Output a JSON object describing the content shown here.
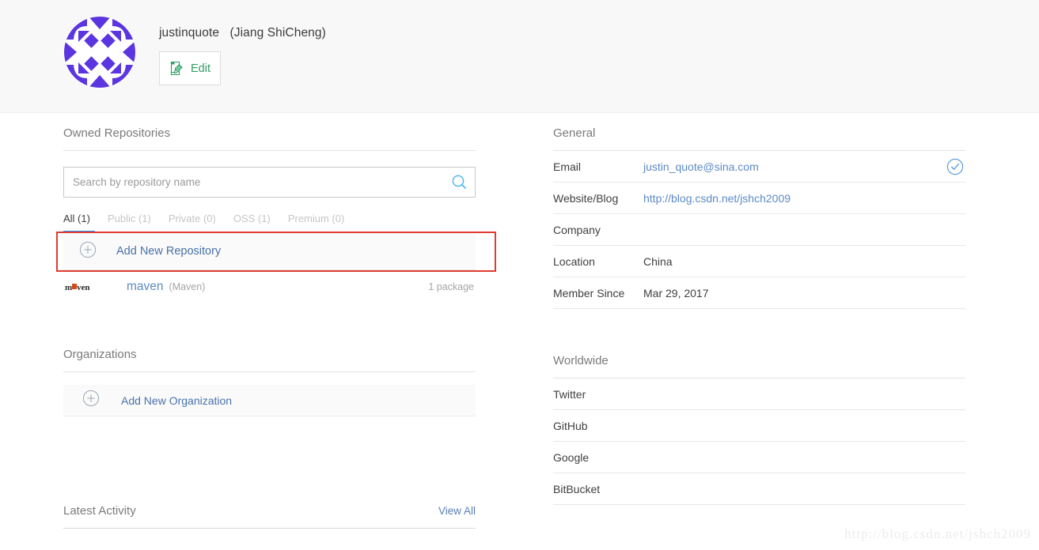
{
  "profile": {
    "username": "justinquote",
    "realname": "(Jiang ShiCheng)",
    "edit_label": "Edit",
    "avatar_alt": "identicon-avatar",
    "avatar_color": "#5b35e0"
  },
  "repositories": {
    "section_title": "Owned Repositories",
    "search": {
      "placeholder": "Search by repository name",
      "value": ""
    },
    "tabs": [
      {
        "label": "All (1)",
        "active": true
      },
      {
        "label": "Public (1)",
        "active": false
      },
      {
        "label": "Private (0)",
        "active": false
      },
      {
        "label": "OSS (1)",
        "active": false
      },
      {
        "label": "Premium (0)",
        "active": false
      }
    ],
    "add_label": "Add New Repository",
    "items": [
      {
        "name": "maven",
        "type": "(Maven)",
        "count": "1 package",
        "logo": "maven-logo"
      }
    ]
  },
  "organizations": {
    "section_title": "Organizations",
    "add_label": "Add New Organization"
  },
  "latest_activity": {
    "section_title": "Latest Activity",
    "view_all_label": "View All"
  },
  "general": {
    "section_title": "General",
    "rows": [
      {
        "label": "Email",
        "value": "justin_quote@sina.com",
        "link": true,
        "verified": true
      },
      {
        "label": "Website/Blog",
        "value": "http://blog.csdn.net/jshch2009",
        "link": true,
        "verified": false
      },
      {
        "label": "Company",
        "value": "",
        "link": false,
        "verified": false
      },
      {
        "label": "Location",
        "value": "China",
        "link": false,
        "verified": false
      },
      {
        "label": "Member Since",
        "value": "Mar 29, 2017",
        "link": false,
        "verified": false
      }
    ]
  },
  "worldwide": {
    "section_title": "Worldwide",
    "rows": [
      {
        "label": "Twitter"
      },
      {
        "label": "GitHub"
      },
      {
        "label": "Google"
      },
      {
        "label": "BitBucket"
      }
    ]
  },
  "watermark": "http://blog.csdn.net/jshch2009",
  "colors": {
    "accent_blue": "#2196f3",
    "link_blue": "#5c8ac4",
    "annotation_red": "#e03b30",
    "edit_green": "#2f9e63",
    "header_bg": "#f8f8f8"
  }
}
